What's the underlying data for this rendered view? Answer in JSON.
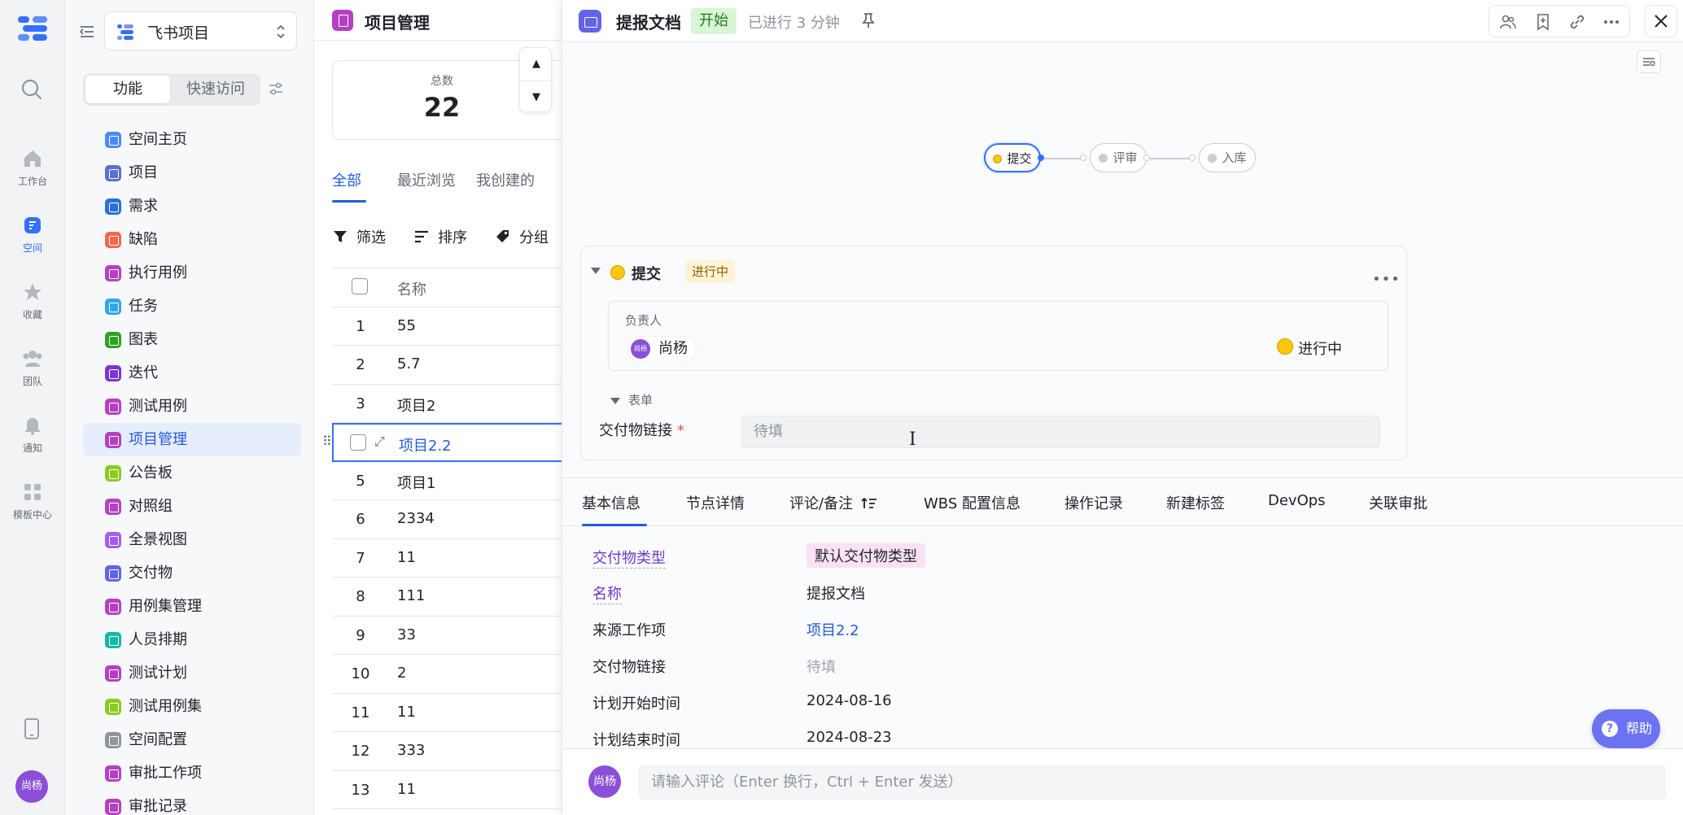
{
  "rail": {
    "items": [
      {
        "label": "工作台",
        "icon": "home-icon"
      },
      {
        "label": "空间",
        "icon": "space-icon"
      },
      {
        "label": "收藏",
        "icon": "star-icon"
      },
      {
        "label": "团队",
        "icon": "team-icon"
      },
      {
        "label": "通知",
        "icon": "bell-icon"
      },
      {
        "label": "模板中心",
        "icon": "grid-icon"
      }
    ],
    "user_avatar": "尚杨",
    "accent": "#3370ff"
  },
  "sidebar": {
    "project_name": "飞书项目",
    "segments": [
      "功能",
      "快速访问"
    ],
    "items": [
      {
        "label": "空间主页",
        "color": "#4c8bf5"
      },
      {
        "label": "项目",
        "color": "#5b6fd6"
      },
      {
        "label": "需求",
        "color": "#2b6fdc"
      },
      {
        "label": "缺陷",
        "color": "#f5674c"
      },
      {
        "label": "执行用例",
        "color": "#b640c2"
      },
      {
        "label": "任务",
        "color": "#2fa8e8"
      },
      {
        "label": "图表",
        "color": "#2ea121"
      },
      {
        "label": "迭代",
        "color": "#7a35d4"
      },
      {
        "label": "测试用例",
        "color": "#b640c2"
      },
      {
        "label": "项目管理",
        "color": "#b640c2"
      },
      {
        "label": "公告板",
        "color": "#8acb1f"
      },
      {
        "label": "对照组",
        "color": "#b640c2"
      },
      {
        "label": "全景视图",
        "color": "#a35cf0"
      },
      {
        "label": "交付物",
        "color": "#6264e8"
      },
      {
        "label": "用例集管理",
        "color": "#b640c2"
      },
      {
        "label": "人员排期",
        "color": "#14b8a6"
      },
      {
        "label": "测试计划",
        "color": "#b640c2"
      },
      {
        "label": "测试用例集",
        "color": "#8acb1f"
      },
      {
        "label": "空间配置",
        "color": "#8f959e"
      },
      {
        "label": "审批工作项",
        "color": "#b640c2"
      },
      {
        "label": "审批记录",
        "color": "#b640c2"
      }
    ],
    "active_index": 9
  },
  "list": {
    "title": "项目管理",
    "stat_label": "总数",
    "stat_value": "22",
    "tabs": [
      "全部",
      "最近浏览",
      "我创建的"
    ],
    "tools": [
      "筛选",
      "排序",
      "分组"
    ],
    "column_name": "名称",
    "rows": [
      {
        "idx": "1",
        "name": "55"
      },
      {
        "idx": "2",
        "name": "5.7"
      },
      {
        "idx": "3",
        "name": "项目2"
      },
      {
        "idx": "",
        "name": "项目2.2"
      },
      {
        "idx": "5",
        "name": "项目1"
      },
      {
        "idx": "6",
        "name": "2334"
      },
      {
        "idx": "7",
        "name": "11"
      },
      {
        "idx": "8",
        "name": "111"
      },
      {
        "idx": "9",
        "name": "33"
      },
      {
        "idx": "10",
        "name": "2"
      },
      {
        "idx": "11",
        "name": "11"
      },
      {
        "idx": "12",
        "name": "333"
      },
      {
        "idx": "13",
        "name": "11"
      }
    ]
  },
  "detail": {
    "title": "提报文档",
    "status_badge": "开始",
    "elapsed": "已进行 3 分钟",
    "flow_nodes": [
      "提交",
      "评审",
      "入库"
    ],
    "node": {
      "title": "提交",
      "badge": "进行中",
      "owner_label": "负责人",
      "owner_avatar": "尚杨",
      "owner_name": "尚杨",
      "owner_status": "进行中",
      "form_toggle": "表单",
      "deliverable_label": "交付物链接",
      "deliverable_required": "*",
      "deliverable_placeholder": "待填"
    },
    "tabs": [
      "基本信息",
      "节点详情",
      "评论/备注",
      "WBS 配置信息",
      "操作记录",
      "新建标签",
      "DevOps",
      "关联审批"
    ],
    "fields": [
      {
        "key": "交付物类型",
        "value": "默认交付物类型"
      },
      {
        "key": "名称",
        "value": "提报文档"
      },
      {
        "key": "来源工作项",
        "value": "项目2.2"
      },
      {
        "key": "交付物链接",
        "value": "待填"
      },
      {
        "key": "计划开始时间",
        "value": "2024-08-16"
      },
      {
        "key": "计划结束时间",
        "value": "2024-08-23"
      }
    ],
    "help_label": "帮助",
    "comment_avatar": "尚杨",
    "comment_placeholder": "请输入评论（Enter 换行，Ctrl + Enter 发送）"
  }
}
